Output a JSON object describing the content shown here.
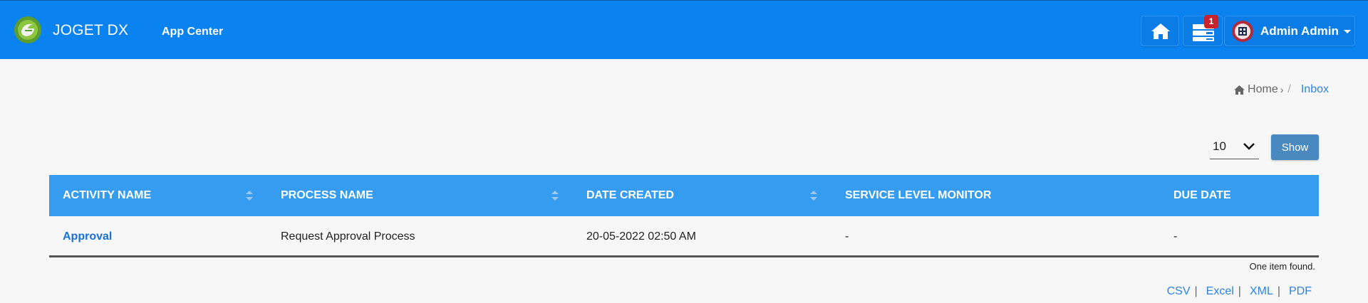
{
  "header": {
    "brand": "JOGET DX",
    "app_center": "App Center",
    "inbox_badge": "1",
    "user_name": "Admin Admin"
  },
  "colors": {
    "header_bg": "#0a82f0",
    "table_header_bg": "#359cf0",
    "link": "#2b83e6",
    "show_button": "#4a88c0",
    "badge": "#c8232c"
  },
  "icons": {
    "logo": "joget-logo-icon",
    "home": "home-icon",
    "inbox": "inbox-tray-icon",
    "avatar": "user-avatar-icon",
    "user_menu": "caret-down-icon",
    "breadcrumb_home": "home-icon",
    "page_size": "chevron-down-icon",
    "sort": "sort-icon"
  },
  "breadcrumb": {
    "home": "Home",
    "separator": "/",
    "current": "Inbox"
  },
  "controls": {
    "page_size": "10",
    "show_label": "Show"
  },
  "table": {
    "columns": [
      {
        "label": "ACTIVITY NAME",
        "sortable": true
      },
      {
        "label": "PROCESS NAME",
        "sortable": true
      },
      {
        "label": "DATE CREATED",
        "sortable": true
      },
      {
        "label": "SERVICE LEVEL MONITOR",
        "sortable": false
      },
      {
        "label": "DUE DATE",
        "sortable": false
      }
    ],
    "rows": [
      {
        "activity_name": "Approval",
        "process_name": "Request Approval Process",
        "date_created": "20-05-2022 02:50 AM",
        "service_level_monitor": "-",
        "due_date": "-"
      }
    ],
    "summary": "One item found."
  },
  "exports": [
    "CSV",
    "Excel",
    "XML",
    "PDF"
  ],
  "export_divider": "|"
}
